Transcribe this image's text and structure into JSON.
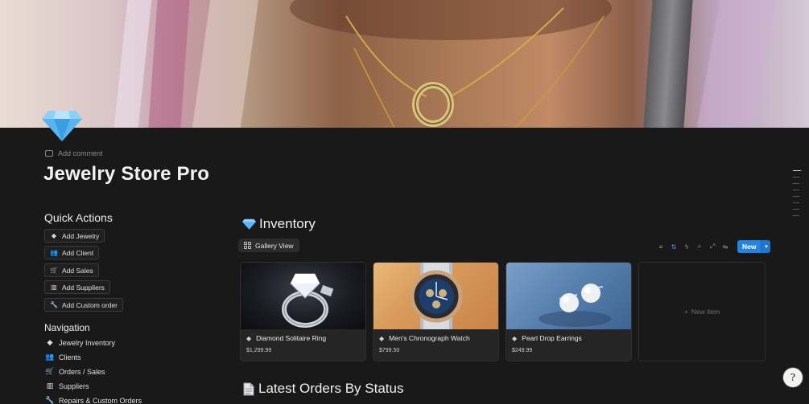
{
  "page": {
    "title": "Jewelry Store Pro",
    "icon": "gem-icon",
    "add_comment": "Add comment"
  },
  "quick_actions": {
    "heading": "Quick Actions",
    "buttons": [
      {
        "label": "Add Jewelry",
        "icon": "gem-icon"
      },
      {
        "label": "Add Client",
        "icon": "people-icon"
      },
      {
        "label": "Add Sales",
        "icon": "cart-icon"
      },
      {
        "label": "Add Suppliers",
        "icon": "factory-icon"
      },
      {
        "label": "Add Custom order",
        "icon": "wrench-icon"
      }
    ]
  },
  "navigation": {
    "heading": "Navigation",
    "items": [
      {
        "label": "Jewelry Inventory",
        "icon": "gem-icon"
      },
      {
        "label": "Clients",
        "icon": "people-icon"
      },
      {
        "label": "Orders / Sales",
        "icon": "cart-icon"
      },
      {
        "label": "Suppliers",
        "icon": "factory-icon"
      },
      {
        "label": "Repairs & Custom Orders",
        "icon": "wrench-icon"
      }
    ]
  },
  "inventory": {
    "heading": "Inventory",
    "view_tab": "Gallery View",
    "new_button": "New",
    "new_item": "New item",
    "toolbar_icons": [
      "filter-icon",
      "sort-icon",
      "lightning-icon",
      "search-icon",
      "expand-icon",
      "settings-icon"
    ],
    "cards": [
      {
        "name": "Diamond Solitaire Ring",
        "price": "$1,299.99",
        "icon": "gem-icon"
      },
      {
        "name": "Men's Chronograph Watch",
        "price": "$799.50",
        "icon": "gem-icon"
      },
      {
        "name": "Pearl Drop Earrings",
        "price": "$249.99",
        "icon": "gem-icon"
      }
    ]
  },
  "orders": {
    "heading": "Latest Orders By Status",
    "icon": "page-icon"
  },
  "colors": {
    "background": "#191919",
    "accent": "#2383e2"
  }
}
